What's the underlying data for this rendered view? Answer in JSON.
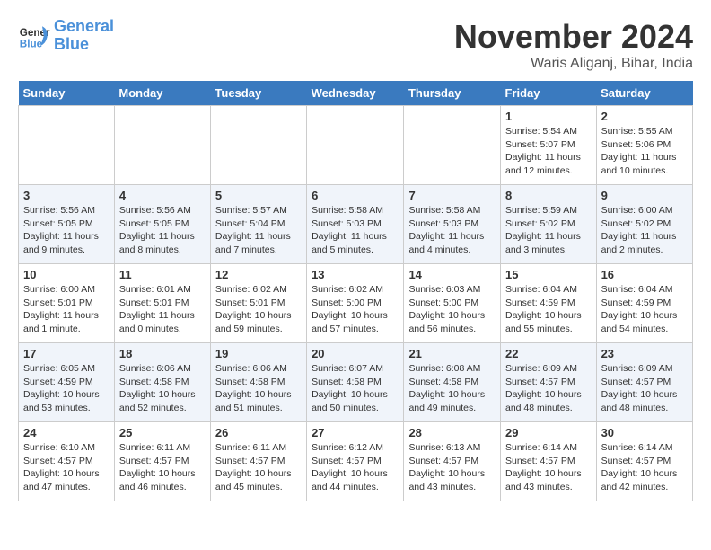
{
  "header": {
    "logo_line1": "General",
    "logo_line2": "Blue",
    "month": "November 2024",
    "location": "Waris Aliganj, Bihar, India"
  },
  "weekdays": [
    "Sunday",
    "Monday",
    "Tuesday",
    "Wednesday",
    "Thursday",
    "Friday",
    "Saturday"
  ],
  "weeks": [
    [
      {
        "day": "",
        "info": ""
      },
      {
        "day": "",
        "info": ""
      },
      {
        "day": "",
        "info": ""
      },
      {
        "day": "",
        "info": ""
      },
      {
        "day": "",
        "info": ""
      },
      {
        "day": "1",
        "info": "Sunrise: 5:54 AM\nSunset: 5:07 PM\nDaylight: 11 hours and 12 minutes."
      },
      {
        "day": "2",
        "info": "Sunrise: 5:55 AM\nSunset: 5:06 PM\nDaylight: 11 hours and 10 minutes."
      }
    ],
    [
      {
        "day": "3",
        "info": "Sunrise: 5:56 AM\nSunset: 5:05 PM\nDaylight: 11 hours and 9 minutes."
      },
      {
        "day": "4",
        "info": "Sunrise: 5:56 AM\nSunset: 5:05 PM\nDaylight: 11 hours and 8 minutes."
      },
      {
        "day": "5",
        "info": "Sunrise: 5:57 AM\nSunset: 5:04 PM\nDaylight: 11 hours and 7 minutes."
      },
      {
        "day": "6",
        "info": "Sunrise: 5:58 AM\nSunset: 5:03 PM\nDaylight: 11 hours and 5 minutes."
      },
      {
        "day": "7",
        "info": "Sunrise: 5:58 AM\nSunset: 5:03 PM\nDaylight: 11 hours and 4 minutes."
      },
      {
        "day": "8",
        "info": "Sunrise: 5:59 AM\nSunset: 5:02 PM\nDaylight: 11 hours and 3 minutes."
      },
      {
        "day": "9",
        "info": "Sunrise: 6:00 AM\nSunset: 5:02 PM\nDaylight: 11 hours and 2 minutes."
      }
    ],
    [
      {
        "day": "10",
        "info": "Sunrise: 6:00 AM\nSunset: 5:01 PM\nDaylight: 11 hours and 1 minute."
      },
      {
        "day": "11",
        "info": "Sunrise: 6:01 AM\nSunset: 5:01 PM\nDaylight: 11 hours and 0 minutes."
      },
      {
        "day": "12",
        "info": "Sunrise: 6:02 AM\nSunset: 5:01 PM\nDaylight: 10 hours and 59 minutes."
      },
      {
        "day": "13",
        "info": "Sunrise: 6:02 AM\nSunset: 5:00 PM\nDaylight: 10 hours and 57 minutes."
      },
      {
        "day": "14",
        "info": "Sunrise: 6:03 AM\nSunset: 5:00 PM\nDaylight: 10 hours and 56 minutes."
      },
      {
        "day": "15",
        "info": "Sunrise: 6:04 AM\nSunset: 4:59 PM\nDaylight: 10 hours and 55 minutes."
      },
      {
        "day": "16",
        "info": "Sunrise: 6:04 AM\nSunset: 4:59 PM\nDaylight: 10 hours and 54 minutes."
      }
    ],
    [
      {
        "day": "17",
        "info": "Sunrise: 6:05 AM\nSunset: 4:59 PM\nDaylight: 10 hours and 53 minutes."
      },
      {
        "day": "18",
        "info": "Sunrise: 6:06 AM\nSunset: 4:58 PM\nDaylight: 10 hours and 52 minutes."
      },
      {
        "day": "19",
        "info": "Sunrise: 6:06 AM\nSunset: 4:58 PM\nDaylight: 10 hours and 51 minutes."
      },
      {
        "day": "20",
        "info": "Sunrise: 6:07 AM\nSunset: 4:58 PM\nDaylight: 10 hours and 50 minutes."
      },
      {
        "day": "21",
        "info": "Sunrise: 6:08 AM\nSunset: 4:58 PM\nDaylight: 10 hours and 49 minutes."
      },
      {
        "day": "22",
        "info": "Sunrise: 6:09 AM\nSunset: 4:57 PM\nDaylight: 10 hours and 48 minutes."
      },
      {
        "day": "23",
        "info": "Sunrise: 6:09 AM\nSunset: 4:57 PM\nDaylight: 10 hours and 48 minutes."
      }
    ],
    [
      {
        "day": "24",
        "info": "Sunrise: 6:10 AM\nSunset: 4:57 PM\nDaylight: 10 hours and 47 minutes."
      },
      {
        "day": "25",
        "info": "Sunrise: 6:11 AM\nSunset: 4:57 PM\nDaylight: 10 hours and 46 minutes."
      },
      {
        "day": "26",
        "info": "Sunrise: 6:11 AM\nSunset: 4:57 PM\nDaylight: 10 hours and 45 minutes."
      },
      {
        "day": "27",
        "info": "Sunrise: 6:12 AM\nSunset: 4:57 PM\nDaylight: 10 hours and 44 minutes."
      },
      {
        "day": "28",
        "info": "Sunrise: 6:13 AM\nSunset: 4:57 PM\nDaylight: 10 hours and 43 minutes."
      },
      {
        "day": "29",
        "info": "Sunrise: 6:14 AM\nSunset: 4:57 PM\nDaylight: 10 hours and 43 minutes."
      },
      {
        "day": "30",
        "info": "Sunrise: 6:14 AM\nSunset: 4:57 PM\nDaylight: 10 hours and 42 minutes."
      }
    ]
  ]
}
